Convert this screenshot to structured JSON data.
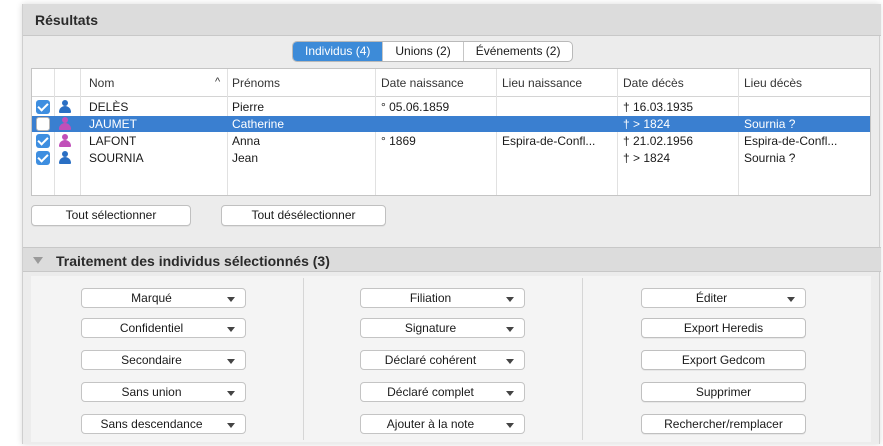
{
  "results": {
    "title": "Résultats"
  },
  "tabs": [
    {
      "label": "Individus (4)",
      "active": true
    },
    {
      "label": "Unions (2)",
      "active": false
    },
    {
      "label": "Événements (2)",
      "active": false
    }
  ],
  "table": {
    "columns": [
      "Nom",
      "Prénoms",
      "Date naissance",
      "Lieu naissance",
      "Date décès",
      "Lieu décès"
    ],
    "sort_indicator": "^",
    "rows": [
      {
        "checked": true,
        "sex": "male",
        "nom": "DELÈS",
        "prenoms": "Pierre",
        "date_naissance": "° 05.06.1859",
        "lieu_naissance": "",
        "date_deces": "† 16.03.1935",
        "lieu_deces": ""
      },
      {
        "checked": false,
        "sex": "female",
        "nom": "JAUMET",
        "prenoms": "Catherine",
        "date_naissance": "",
        "lieu_naissance": "",
        "date_deces": "† > 1824",
        "lieu_deces": "Sournia ?",
        "selected": true
      },
      {
        "checked": true,
        "sex": "female",
        "nom": "LAFONT",
        "prenoms": "Anna",
        "date_naissance": "° 1869",
        "lieu_naissance": "Espira-de-Confl...",
        "date_deces": "† 21.02.1956",
        "lieu_deces": "Espira-de-Confl..."
      },
      {
        "checked": true,
        "sex": "male",
        "nom": "SOURNIA",
        "prenoms": "Jean",
        "date_naissance": "",
        "lieu_naissance": "",
        "date_deces": "† > 1824",
        "lieu_deces": "Sournia ?"
      }
    ]
  },
  "buttons": {
    "select_all": "Tout sélectionner",
    "deselect_all": "Tout désélectionner"
  },
  "treatment": {
    "title": "Traitement des individus sélectionnés (3)",
    "col1": [
      "Marqué",
      "Confidentiel",
      "Secondaire",
      "Sans union",
      "Sans descendance"
    ],
    "col2": [
      "Filiation",
      "Signature",
      "Déclaré cohérent",
      "Déclaré complet",
      "Ajouter à la note"
    ],
    "col3": [
      "Éditer",
      "Export Heredis",
      "Export Gedcom",
      "Supprimer",
      "Rechercher/remplacer"
    ]
  },
  "colors": {
    "accent": "#3d8bd8",
    "selected_row": "#3a7fd0",
    "male_icon": "#2a6fc4",
    "female_icon": "#c14fb9"
  }
}
